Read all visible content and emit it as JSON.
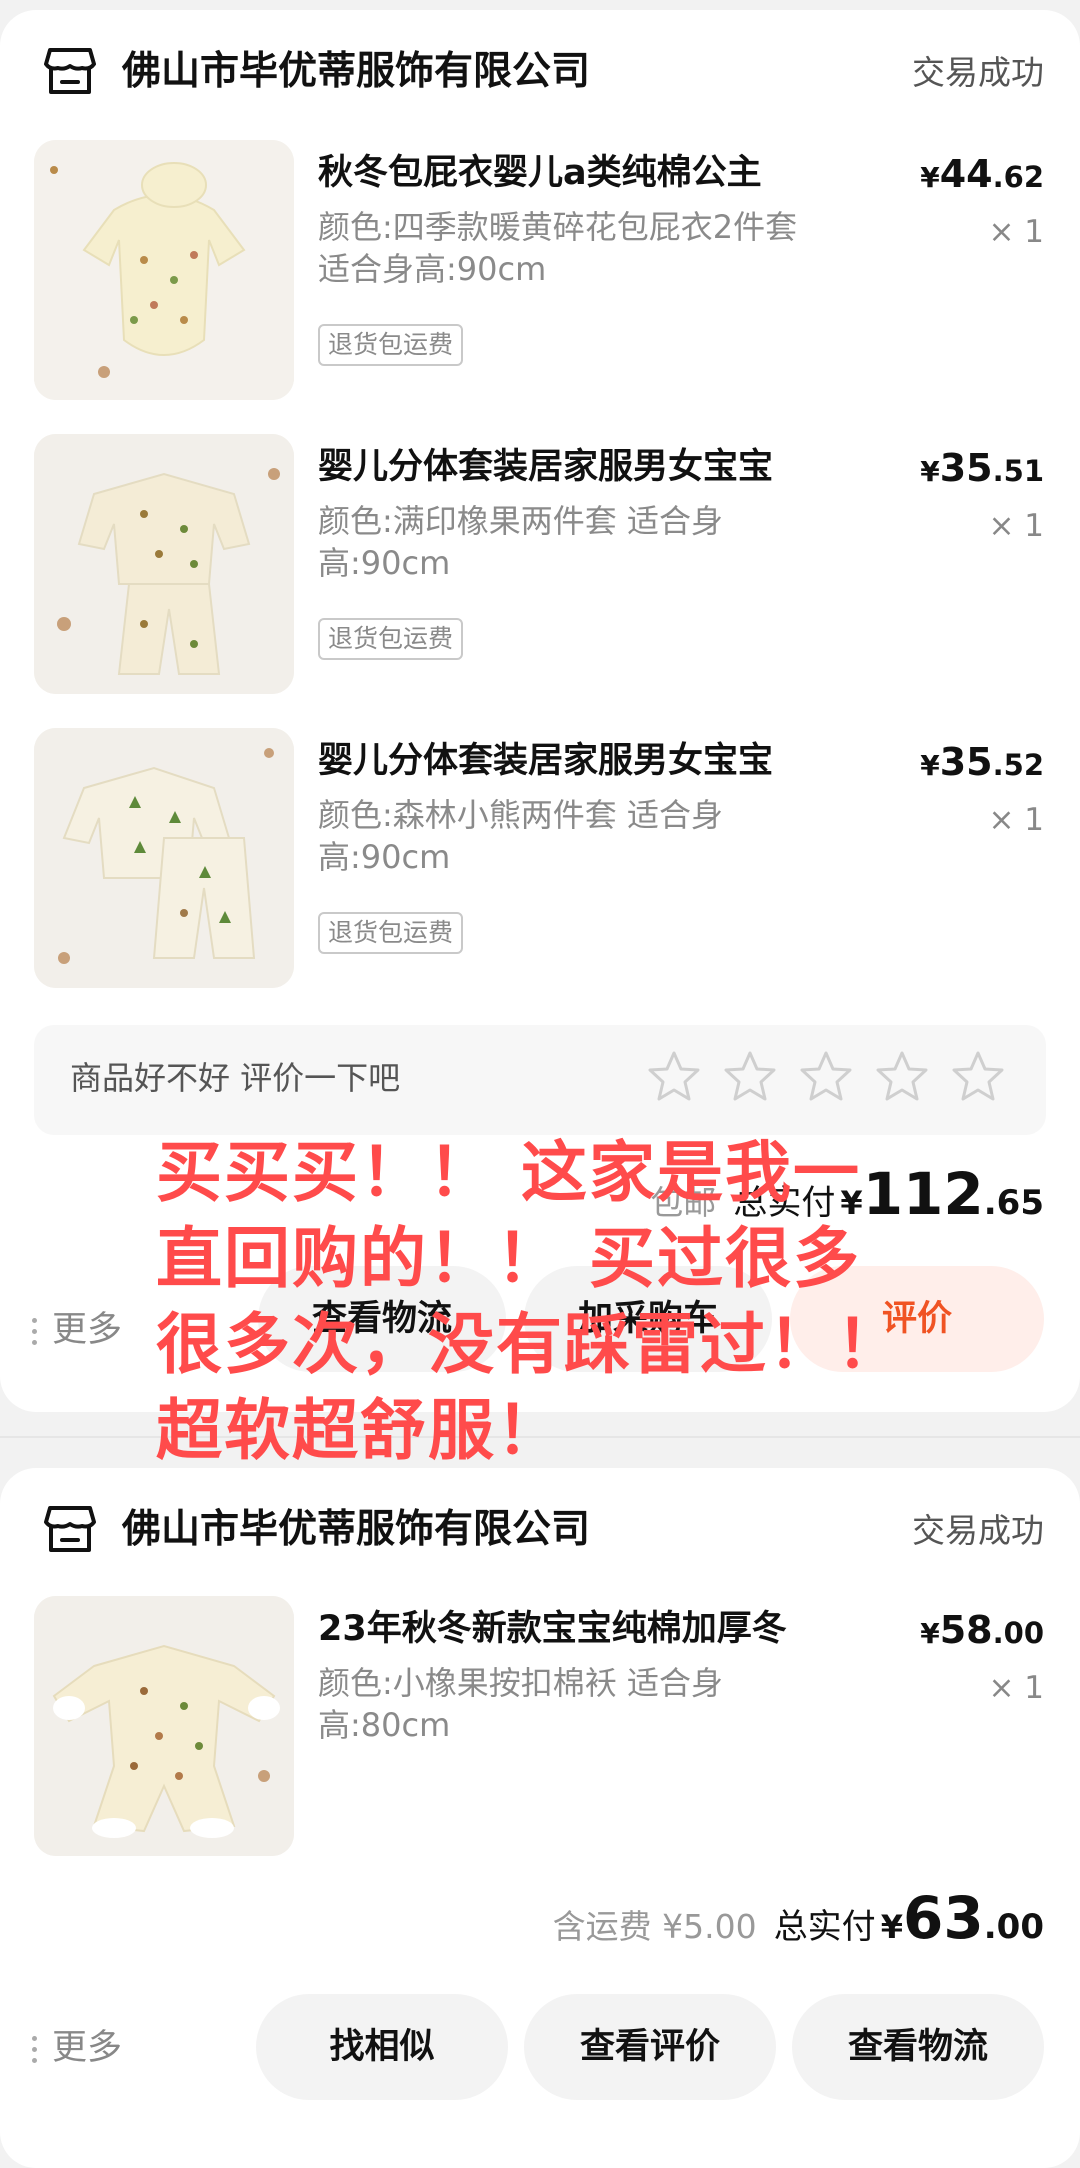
{
  "orders": [
    {
      "shop_name": "佛山市毕优蒂服饰有限公司",
      "status": "交易成功",
      "items": [
        {
          "title": "秋冬包屁衣婴儿a类纯棉公主",
          "price_cur": "¥",
          "price_int": "44",
          "price_dec": ".62",
          "spec": "颜色:四季款暖黄碎花包屁衣2件套 适合身高:90cm",
          "qty": "× 1",
          "tag": "退货包运费"
        },
        {
          "title": "婴儿分体套装居家服男女宝宝",
          "price_cur": "¥",
          "price_int": "35",
          "price_dec": ".51",
          "spec": "颜色:满印橡果两件套 适合身高:90cm",
          "qty": "× 1",
          "tag": "退货包运费"
        },
        {
          "title": "婴儿分体套装居家服男女宝宝",
          "price_cur": "¥",
          "price_int": "35",
          "price_dec": ".52",
          "spec": "颜色:森林小熊两件套 适合身高:90cm",
          "qty": "× 1",
          "tag": "退货包运费"
        }
      ],
      "rate_prompt": "商品好不好 评价一下吧",
      "shipping_note": "包邮",
      "total_label": "总实付",
      "total_cur": "¥",
      "total_int": "112",
      "total_dec": ".65",
      "more_label": "更多",
      "buttons": [
        "查看物流",
        "加采购车",
        "评价"
      ]
    },
    {
      "shop_name": "佛山市毕优蒂服饰有限公司",
      "status": "交易成功",
      "items": [
        {
          "title": "23年秋冬新款宝宝纯棉加厚冬",
          "price_cur": "¥",
          "price_int": "58",
          "price_dec": ".00",
          "spec": "颜色:小橡果按扣棉袄 适合身高:80cm",
          "qty": "× 1"
        }
      ],
      "shipping_note": "含运费 ¥5.00",
      "total_label": "总实付",
      "total_cur": "¥",
      "total_int": "63",
      "total_dec": ".00",
      "more_label": "更多",
      "buttons": [
        "找相似",
        "查看评价",
        "查看物流"
      ]
    }
  ],
  "overlay_text": "买买买！！ 这家是我一直回购的！！ 买过很多很多次，没有踩雷过！！ 超软超舒服！",
  "colors": {
    "accent": "#f05323",
    "overlay": "#ff4b4b",
    "background": "#f2f2f2"
  },
  "icons": {
    "shop": "shop-icon",
    "star": "star-outline-icon"
  }
}
